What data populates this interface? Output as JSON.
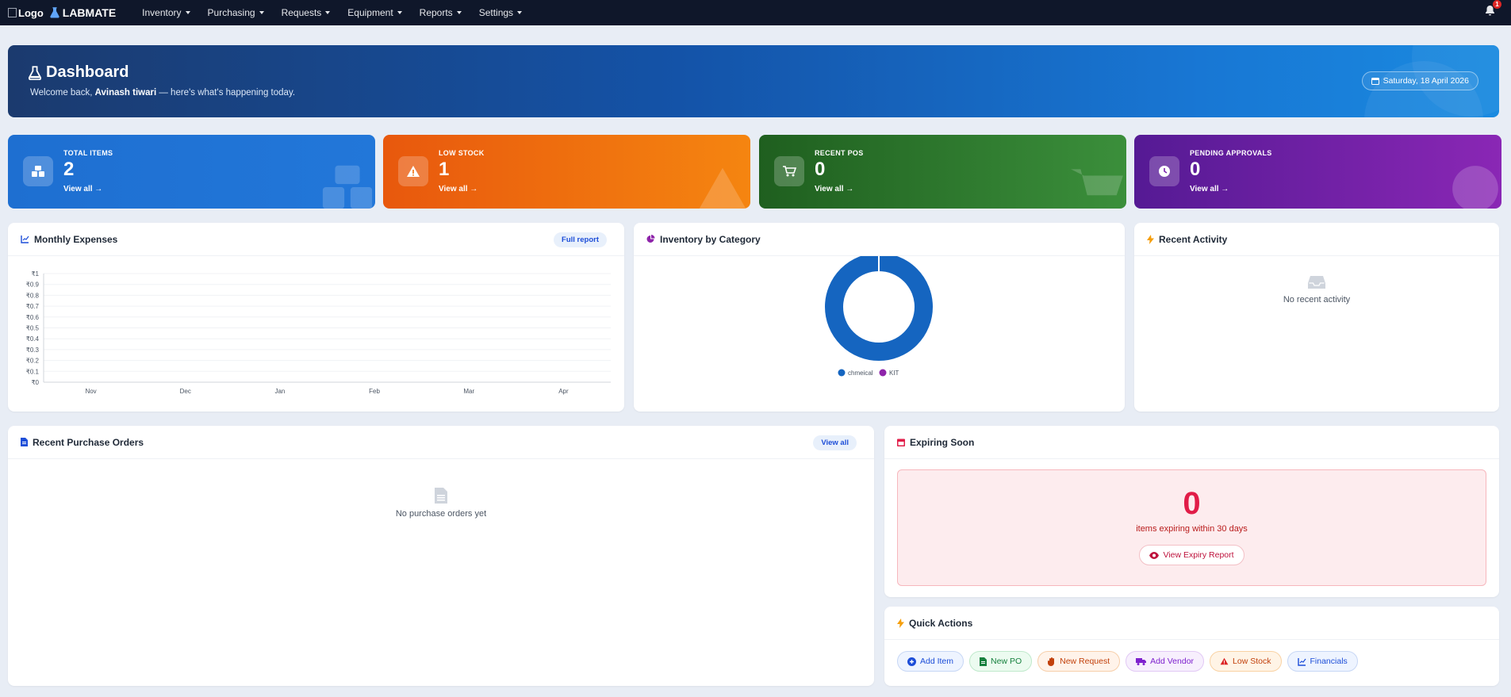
{
  "nav": {
    "logo_alt": "Logo",
    "brand": "LABMATE",
    "menu": [
      "Inventory",
      "Purchasing",
      "Requests",
      "Equipment",
      "Reports",
      "Settings"
    ],
    "notification_count": "1"
  },
  "hero": {
    "title": "Dashboard",
    "welcome_prefix": "Welcome back,",
    "user": "Avinash tiwari",
    "welcome_suffix": "— here's what's happening today.",
    "date": "Saturday, 18 April 2026"
  },
  "stats": [
    {
      "label": "TOTAL ITEMS",
      "value": "2",
      "link": "View all →",
      "icon": "boxes-icon"
    },
    {
      "label": "LOW STOCK",
      "value": "1",
      "link": "View all →",
      "icon": "warning-icon"
    },
    {
      "label": "RECENT POS",
      "value": "0",
      "link": "View all →",
      "icon": "cart-icon"
    },
    {
      "label": "PENDING APPROVALS",
      "value": "0",
      "link": "View all →",
      "icon": "clock-icon"
    }
  ],
  "expenses": {
    "title": "Monthly Expenses",
    "action": "Full report"
  },
  "inventory": {
    "title": "Inventory by Category"
  },
  "activity": {
    "title": "Recent Activity",
    "empty": "No recent activity"
  },
  "purchase_orders": {
    "title": "Recent Purchase Orders",
    "action": "View all",
    "empty": "No purchase orders yet"
  },
  "expiring": {
    "title": "Expiring Soon",
    "count": "0",
    "text": "items expiring within 30 days",
    "button": "View Expiry Report"
  },
  "quick_actions": {
    "title": "Quick Actions",
    "items": [
      "Add Item",
      "New PO",
      "New Request",
      "Add Vendor",
      "Low Stock",
      "Financials"
    ]
  },
  "colors": {
    "navbar": "#0f172a",
    "blue": "#1e6fd1",
    "orange": "#f58510",
    "green": "#2f7d2f",
    "purple": "#7a24ac",
    "donut_chemical": "#1565c0",
    "donut_kit": "#8e24aa"
  },
  "chart_data": [
    {
      "type": "bar",
      "title": "Monthly Expenses",
      "categories": [
        "Nov",
        "Dec",
        "Jan",
        "Feb",
        "Mar",
        "Apr"
      ],
      "values": [
        0,
        0,
        0,
        0,
        0,
        0
      ],
      "yticks": [
        "₹0",
        "₹0.1",
        "₹0.2",
        "₹0.3",
        "₹0.4",
        "₹0.5",
        "₹0.6",
        "₹0.7",
        "₹0.8",
        "₹0.9",
        "₹1"
      ],
      "ylim": [
        0,
        1
      ],
      "grid": true
    },
    {
      "type": "pie",
      "title": "Inventory by Category",
      "labels": [
        "chmeical",
        "KIT"
      ],
      "values": [
        1,
        0
      ],
      "legend": "bottom"
    }
  ]
}
